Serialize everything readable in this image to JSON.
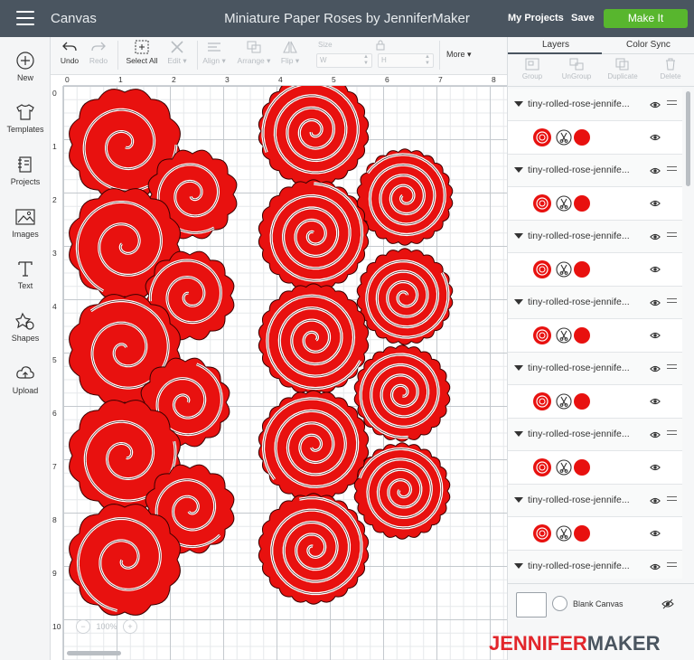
{
  "header": {
    "app_name": "Canvas",
    "title": "Miniature Paper Roses by JenniferMaker",
    "my_projects": "My Projects",
    "save": "Save",
    "make_it": "Make It"
  },
  "sidebar": {
    "items": [
      {
        "label": "New",
        "icon": "plus-circle-icon"
      },
      {
        "label": "Templates",
        "icon": "tshirt-icon"
      },
      {
        "label": "Projects",
        "icon": "notebook-icon"
      },
      {
        "label": "Images",
        "icon": "image-icon"
      },
      {
        "label": "Text",
        "icon": "text-t-icon"
      },
      {
        "label": "Shapes",
        "icon": "shapes-icon"
      },
      {
        "label": "Upload",
        "icon": "cloud-upload-icon"
      }
    ]
  },
  "toolbar": {
    "undo": "Undo",
    "redo": "Redo",
    "select_all": "Select All",
    "edit": "Edit",
    "align": "Align",
    "arrange": "Arrange",
    "flip": "Flip",
    "size": "Size",
    "w": "W",
    "h": "H",
    "more": "More"
  },
  "ruler": {
    "top": [
      "0",
      "1",
      "2",
      "3",
      "4",
      "5",
      "6",
      "7",
      "8"
    ],
    "left": [
      "0",
      "1",
      "2",
      "3",
      "4",
      "5",
      "6",
      "7",
      "8",
      "9",
      "10"
    ]
  },
  "zoom": {
    "minus": "−",
    "value": "100%",
    "plus": "+"
  },
  "panel": {
    "tabs": {
      "layers": "Layers",
      "color_sync": "Color Sync"
    },
    "tools": {
      "group": "Group",
      "ungroup": "UnGroup",
      "duplicate": "Duplicate",
      "delete": "Delete"
    },
    "layers": [
      {
        "name": "tiny-rolled-rose-jennife..."
      },
      {
        "name": "tiny-rolled-rose-jennife..."
      },
      {
        "name": "tiny-rolled-rose-jennife..."
      },
      {
        "name": "tiny-rolled-rose-jennife..."
      },
      {
        "name": "tiny-rolled-rose-jennife..."
      },
      {
        "name": "tiny-rolled-rose-jennife..."
      },
      {
        "name": "tiny-rolled-rose-jennife..."
      },
      {
        "name": "tiny-rolled-rose-jennife..."
      }
    ],
    "layer_color": "#e8110f",
    "blank_canvas": "Blank Canvas"
  },
  "watermark": {
    "part1": "JENNIFER",
    "part2": "MAKER"
  },
  "colors": {
    "topbar": "#4a5560",
    "make_it": "#58b62e",
    "rose_red": "#e8110f"
  }
}
